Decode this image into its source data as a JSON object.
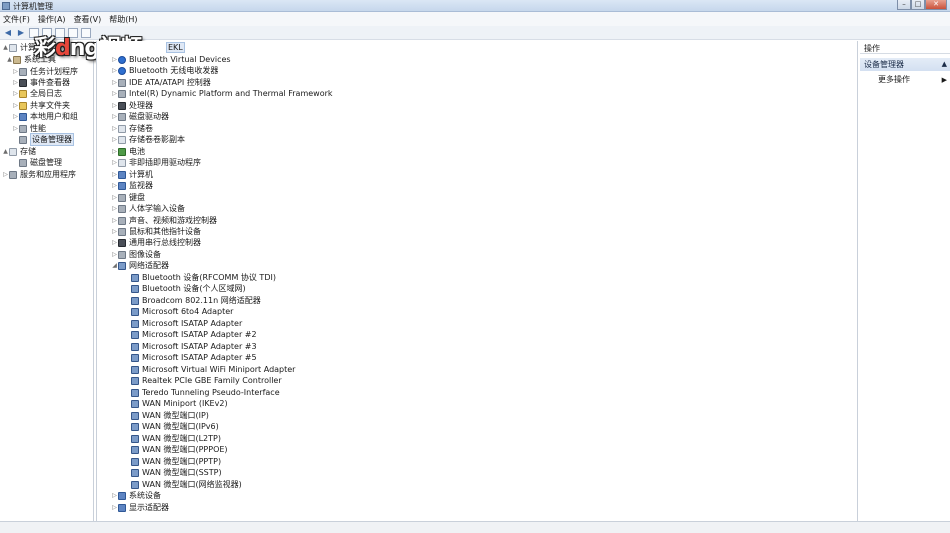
{
  "window": {
    "title": "计算机管理"
  },
  "menu": [
    "文件(F)",
    "操作(A)",
    "查看(V)",
    "帮助(H)"
  ],
  "watermark": {
    "pre": "彩",
    "mid": "d",
    "post": "ng视频"
  },
  "left_tree": [
    {
      "label": "计算机管理",
      "exp": "▲",
      "icon": "computer-icon"
    },
    {
      "label": "系统工具",
      "exp": "▲",
      "icon": "tools-icon"
    },
    {
      "label": "任务计划程序",
      "exp": "▷",
      "icon": "clock-icon"
    },
    {
      "label": "事件查看器",
      "exp": "▷",
      "icon": "event-viewer-icon"
    },
    {
      "label": "共享文件夹",
      "exp": "▷",
      "icon": "shared-folder-icon"
    },
    {
      "label": "本地用户和组",
      "exp": "▷",
      "icon": "users-icon"
    },
    {
      "label": "性能",
      "exp": "▷",
      "icon": "performance-icon"
    },
    {
      "label": "设备管理器",
      "exp": "",
      "icon": "device-manager-icon"
    },
    {
      "label": "存储",
      "exp": "▲",
      "icon": "storage-icon"
    },
    {
      "label": "磁盘管理",
      "exp": "",
      "icon": "disk-icon"
    },
    {
      "label": "服务和应用程序",
      "exp": "▷",
      "icon": "services-icon"
    }
  ],
  "device_tree": {
    "root": "EKL",
    "groups": [
      {
        "label": "Bluetooth Virtual Devices",
        "icon": "bluetooth-icon"
      },
      {
        "label": "Bluetooth 无线电收发器",
        "icon": "bluetooth-icon"
      },
      {
        "label": "IDE ATA/ATAPI 控制器",
        "icon": "ide-controller-icon"
      },
      {
        "label": "Intel(R) Dynamic Platform and Thermal Framework",
        "icon": "chip-icon"
      },
      {
        "label": "处理器",
        "icon": "processor-icon"
      },
      {
        "label": "磁盘驱动器",
        "icon": "disk-drive-icon"
      },
      {
        "label": "存储卷",
        "icon": "volume-icon"
      },
      {
        "label": "存储卷卷影副本",
        "icon": "volume-icon"
      },
      {
        "label": "电池",
        "icon": "battery-icon"
      },
      {
        "label": "非即插即用驱动程序",
        "icon": "driver-icon"
      },
      {
        "label": "计算机",
        "icon": "computer-icon"
      },
      {
        "label": "监视器",
        "icon": "monitor-icon"
      },
      {
        "label": "键盘",
        "icon": "keyboard-icon"
      },
      {
        "label": "人体学输入设备",
        "icon": "hid-icon"
      },
      {
        "label": "声音、视频和游戏控制器",
        "icon": "sound-icon"
      },
      {
        "label": "鼠标和其他指针设备",
        "icon": "mouse-icon"
      },
      {
        "label": "通用串行总线控制器",
        "icon": "usb-icon"
      },
      {
        "label": "图像设备",
        "icon": "camera-icon"
      },
      {
        "label": "网络适配器",
        "icon": "network-adapter-icon",
        "expanded": true
      }
    ],
    "network_adapters": [
      "Bluetooth 设备(RFCOMM 协议 TDI)",
      "Bluetooth 设备(个人区域网)",
      "Broadcom 802.11n 网络适配器",
      "Microsoft 6to4 Adapter",
      "Microsoft ISATAP Adapter",
      "Microsoft ISATAP Adapter #2",
      "Microsoft ISATAP Adapter #3",
      "Microsoft ISATAP Adapter #5",
      "Microsoft Virtual WiFi Miniport Adapter",
      "Realtek PCIe GBE Family Controller",
      "Teredo Tunneling Pseudo-Interface",
      "WAN Miniport (IKEv2)",
      "WAN 微型端口(IP)",
      "WAN 微型端口(IPv6)",
      "WAN 微型端口(L2TP)",
      "WAN 微型端口(PPPOE)",
      "WAN 微型端口(PPTP)",
      "WAN 微型端口(SSTP)",
      "WAN 微型端口(网络监视器)"
    ],
    "tail_groups": [
      {
        "label": "系统设备",
        "icon": "system-devices-icon"
      },
      {
        "label": "显示适配器",
        "icon": "display-adapter-icon"
      }
    ]
  },
  "actions": {
    "header": "操作",
    "section": "设备管理器",
    "more": "更多操作"
  }
}
